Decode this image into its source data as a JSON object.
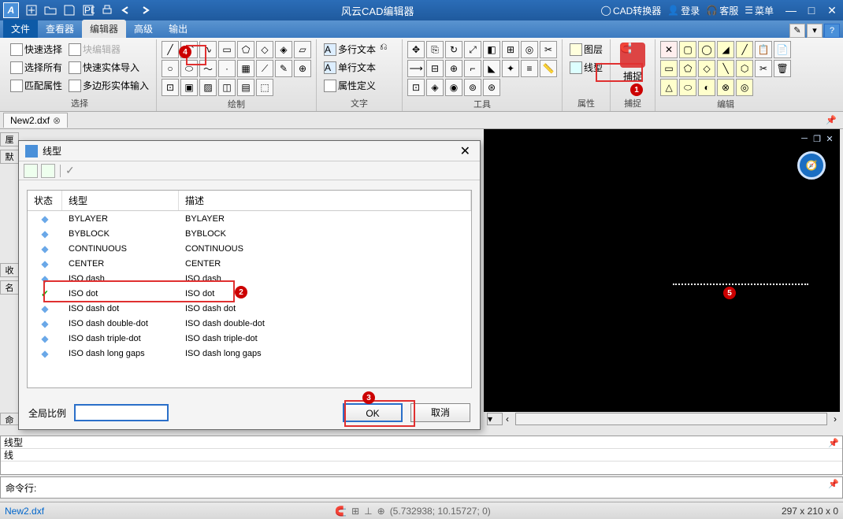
{
  "titlebar": {
    "app_title": "风云CAD编辑器",
    "right": {
      "converter": "CAD转换器",
      "login": "登录",
      "support": "客服",
      "menu": "菜单"
    }
  },
  "menutabs": {
    "file": "文件",
    "viewer": "查看器",
    "editor": "编辑器",
    "advanced": "高级",
    "output": "输出"
  },
  "ribbon": {
    "select": {
      "quick_select": "快速选择",
      "select_all": "选择所有",
      "match_props": "匹配属性",
      "block_editor": "块编辑器",
      "fast_import": "快速实体导入",
      "poly_import": "多边形实体输入",
      "label": "选择"
    },
    "draw": {
      "label": "绘制"
    },
    "text": {
      "multiline": "多行文本",
      "single": "单行文本",
      "attrdef": "属性定义",
      "label": "文字"
    },
    "tools": {
      "label": "工具"
    },
    "props": {
      "layers": "图层",
      "linetype": "线型",
      "label": "属性"
    },
    "snap": {
      "btn": "捕捉",
      "label": "捕捉"
    },
    "edit": {
      "label": "编辑"
    }
  },
  "doc": {
    "name": "New2.dxf"
  },
  "side": {
    "default": "默"
  },
  "dialog": {
    "title": "线型",
    "headers": {
      "status": "状态",
      "linetype": "线型",
      "desc": "描述"
    },
    "rows": [
      {
        "lt": "BYLAYER",
        "desc": "BYLAYER",
        "sel": false
      },
      {
        "lt": "BYBLOCK",
        "desc": "BYBLOCK",
        "sel": false
      },
      {
        "lt": "CONTINUOUS",
        "desc": "CONTINUOUS",
        "sel": false
      },
      {
        "lt": "CENTER",
        "desc": "CENTER",
        "sel": false
      },
      {
        "lt": "ISO dash",
        "desc": "ISO dash",
        "sel": false
      },
      {
        "lt": "ISO dot",
        "desc": "ISO dot",
        "sel": true
      },
      {
        "lt": "ISO dash dot",
        "desc": "ISO dash dot",
        "sel": false
      },
      {
        "lt": "ISO dash double-dot",
        "desc": "ISO dash double-dot",
        "sel": false
      },
      {
        "lt": "ISO dash triple-dot",
        "desc": "ISO dash triple-dot",
        "sel": false
      },
      {
        "lt": "ISO dash long gaps",
        "desc": "ISO dash long gaps",
        "sel": false
      }
    ],
    "scale_label": "全局比例",
    "ok": "OK",
    "cancel": "取消"
  },
  "props_panel": {
    "r1": "线型",
    "r2": "线"
  },
  "cmd": {
    "label": "命令行:"
  },
  "status": {
    "file": "New2.dxf",
    "coords": "(5.732938; 10.15727; 0)",
    "paper": "297 x 210 x 0"
  },
  "badges": {
    "b1": "1",
    "b2": "2",
    "b3": "3",
    "b4": "4",
    "b5": "5"
  }
}
